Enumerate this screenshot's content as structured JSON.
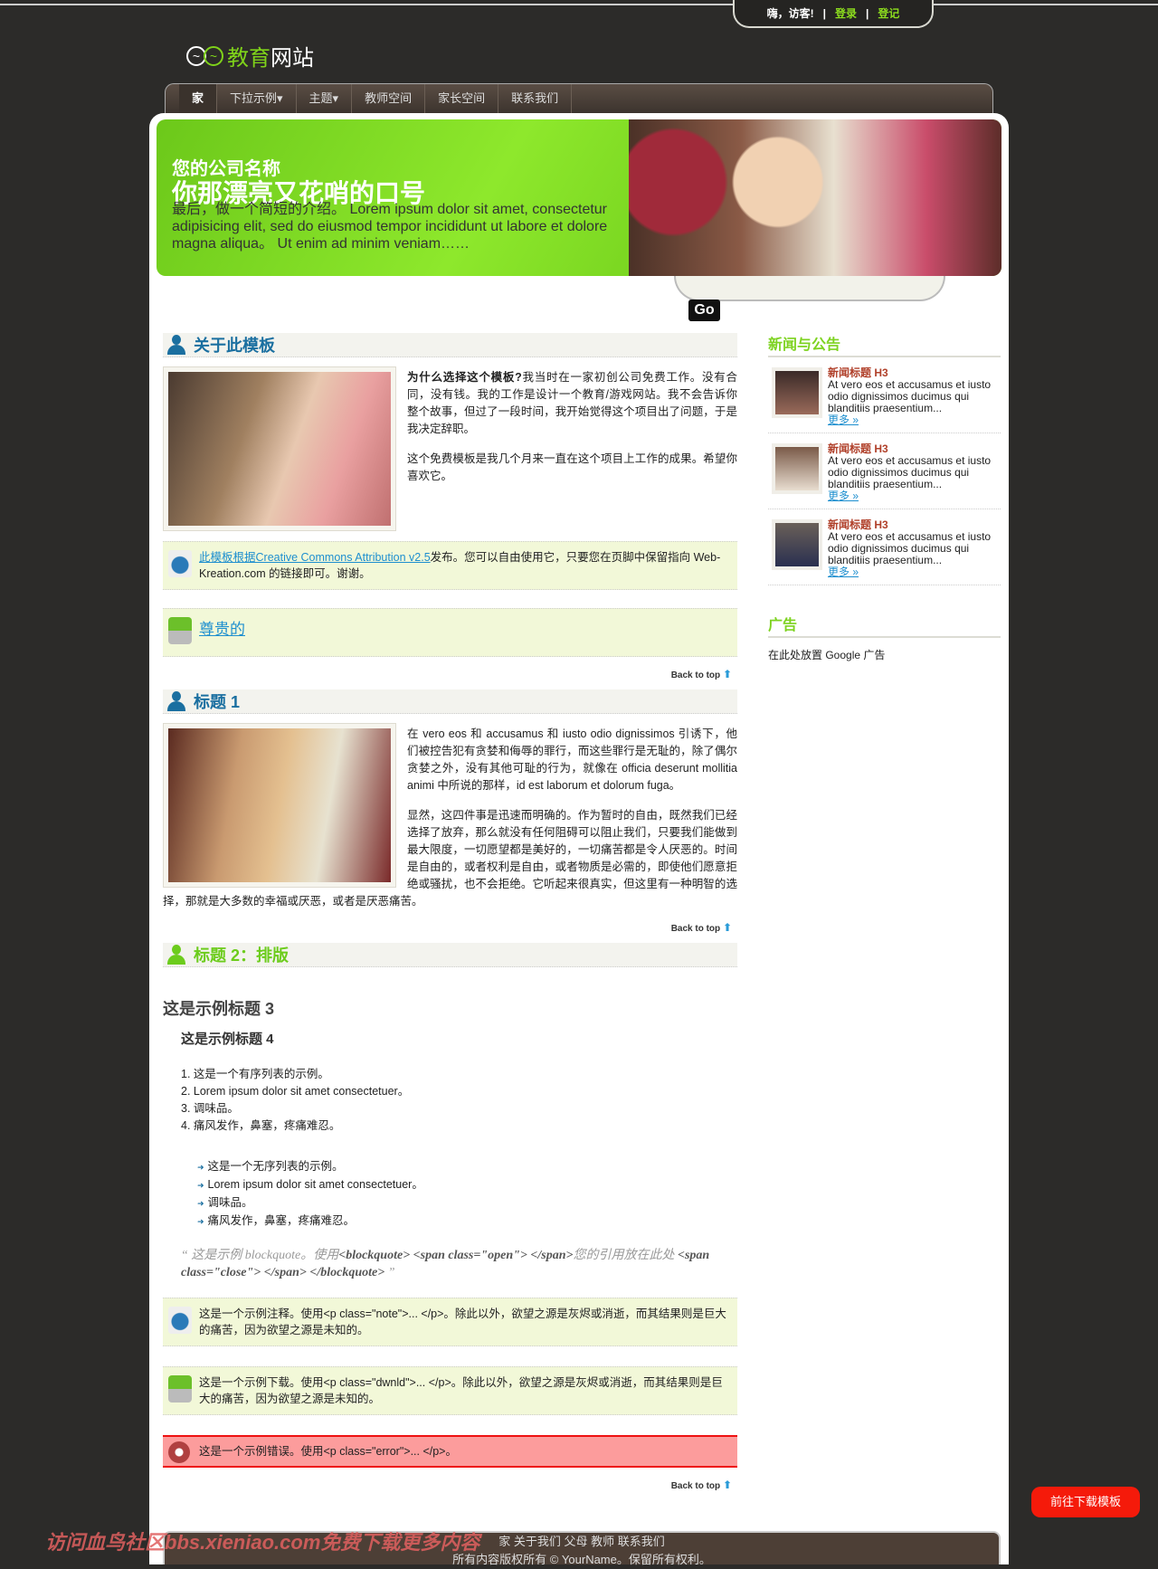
{
  "top": {
    "greeting": "嗨，访客!",
    "sep": "|",
    "login": "登录",
    "register": "登记"
  },
  "logo": {
    "part1": "教育",
    "part2": "网站"
  },
  "nav": [
    "家",
    "下拉示例▾",
    "主题▾",
    "教师空间",
    "家长空间",
    "联系我们"
  ],
  "banner": {
    "company": "您的公司名称",
    "slogan": "你那漂亮又花哨的口号",
    "intro": "最后，做一个简短的介绍。 Lorem ipsum dolor sit amet, consectetur adipisicing elit, sed do eiusmod tempor incididunt ut labore et dolore magna aliqua。 Ut enim ad minim veniam……",
    "go": "Go"
  },
  "about": {
    "title": "关于此模板",
    "lead": "为什么选择这个模板?",
    "p1": "我当时在一家初创公司免费工作。没有合同，没有钱。我的工作是设计一个教育/游戏网站。我不会告诉你整个故事，但过了一段时间，我开始觉得这个项目出了问题，于是我决定辞职。",
    "p2": "这个免费模板是我几个月来一直在这个项目上工作的成果。希望你喜欢它。",
    "note_link": "此模板根据Creative Commons Attribution v2.5",
    "note_text": "发布。您可以自由使用它，只要您在页脚中保留指向 Web-Kreation.com 的链接即可。谢谢。",
    "download_link": "尊贵的"
  },
  "back_to_top": "Back to top",
  "section1": {
    "title": "标题 1",
    "p1": "在 vero eos 和 accusamus 和 iusto odio dignissimos 引诱下，他们被控告犯有贪婪和侮辱的罪行，而这些罪行是无耻的，除了偶尔贪婪之外，没有其他可耻的行为，就像在 officia deserunt mollitia animi 中所说的那样，id est laborum et dolorum fuga。",
    "p2": "显然，这四件事是迅速而明确的。作为暂时的自由，既然我们已经选择了放弃，那么就没有任何阻碍可以阻止我们，只要我们能做到最大限度，一切愿望都是美好的，一切痛苦都是令人厌恶的。时间是自由的，或者权利是自由，或者物质是必需的，即使他们愿意拒绝或骚扰，也不会拒绝。它听起来很真实，但这里有一种明智的选择，那就是大多数的幸福或厌恶，或者是厌恶痛苦。"
  },
  "section2": {
    "title": "标题 2：排版",
    "h3": "这是示例标题 3",
    "h4": "这是示例标题 4",
    "ol": [
      "1. 这是一个有序列表的示例。",
      "2. Lorem ipsum dolor sit amet consectetuer。",
      "3. 调味品。",
      "4. 痛风发作，鼻塞，疼痛难忍。"
    ],
    "ul": [
      "这是一个无序列表的示例。",
      "Lorem ipsum dolor sit amet consectetuer。",
      "调味品。",
      "痛风发作，鼻塞，疼痛难忍。"
    ],
    "quote_a": "这是示例 blockquote。使用",
    "quote_b": "<blockquote> <span class=\"open\"> </span>",
    "quote_c": "您的引用放在此处",
    "quote_d": "<span class=\"close\"> </span> </blockquote>",
    "note": "这是一个示例注释。使用<p class=\"note\">... </p>。除此以外，欲望之源是灰烬或消逝，而其结果则是巨大的痛苦，因为欲望之源是未知的。",
    "dwnld": "这是一个示例下载。使用<p class=\"dwnld\">... </p>。除此以外，欲望之源是灰烬或消逝，而其结果则是巨大的痛苦，因为欲望之源是未知的。",
    "error": "这是一个示例错误。使用<p class=\"error\">... </p>。"
  },
  "sidebar": {
    "news_title": "新闻与公告",
    "news": [
      {
        "title": "新闻标题 H3",
        "text": "At vero eos et accusamus et iusto odio dignissimos ducimus qui blanditiis praesentium...",
        "more": "更多 »"
      },
      {
        "title": "新闻标题 H3",
        "text": "At vero eos et accusamus et iusto odio dignissimos ducimus qui blanditiis praesentium...",
        "more": "更多 »"
      },
      {
        "title": "新闻标题 H3",
        "text": "At vero eos et accusamus et iusto odio dignissimos ducimus qui blanditiis praesentium...",
        "more": "更多 »"
      }
    ],
    "ads_title": "广告",
    "ads_text": "在此处放置 Google 广告"
  },
  "footer": {
    "links": "家 关于我们 父母 教师 联系我们",
    "copyright": "所有内容版权所有 © YourName。保留所有权利。"
  },
  "download_button": "前往下载模板",
  "watermark": "访问血鸟社区bbs.xieniao.com免费下载更多内容"
}
